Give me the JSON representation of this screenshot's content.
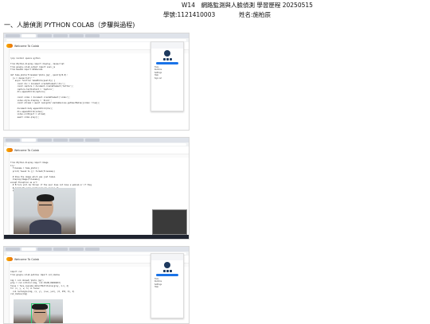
{
  "header": {
    "title": "W14　網路監測與人臉偵測 學習歷程 20250515",
    "student_id": "學號:1121410003",
    "student_name": "姓名:施柏辰"
  },
  "section": {
    "heading": "一、人臉偵測 PYTHON COLAB（步驟與過程)"
  },
  "screenshots": [
    {
      "notebook": "Welcome To Colab",
      "code_lines": [
        "!pip install opencv-python",
        "",
        "from IPython.display import display, Javascript",
        "from google.colab.output import eval_js",
        "from base64 import b64decode",
        "",
        "def take_photo(filename='photo.jpg', quality=0.8):",
        "  js = Javascript('''",
        "    async function takePhoto(quality) {",
        "      const div = document.createElement('div');",
        "      const capture = document.createElement('button');",
        "      capture.textContent = 'Capture';",
        "      div.appendChild(capture);",
        "",
        "      const video = document.createElement('video');",
        "      video.style.display = 'block';",
        "      const stream = await navigator.mediaDevices.getUserMedia({video: true});",
        "",
        "      document.body.appendChild(div);",
        "      div.appendChild(video);",
        "      video.srcObject = stream;",
        "      await video.play();"
      ]
    },
    {
      "notebook": "Welcome To Colab",
      "code_lines": [
        "from IPython.display import Image",
        "try:",
        "  filename = take_photo()",
        "  print('Saved to {}'.format(filename))",
        "",
        "  # Show the image which was just taken.",
        "  display(Image(filename))",
        "except Exception as err:",
        "  # Errors will be thrown if the user does not have a webcam or if they",
        "  # grant the page permission to access it.",
        "  print(str(err))"
      ]
    },
    {
      "notebook": "Welcome To Colab",
      "code_lines": [
        "import cv2",
        "from google.colab.patches import cv2_imshow",
        "",
        "img = cv2.imread('photo.jpg')",
        "gray = cv2.cvtColor(img, cv2.COLOR_BGR2GRAY)",
        "faces = face_cascade.detectMultiScale(gray, 1.1, 4)",
        "for (x, y, w, h) in faces:",
        "  cv2.rectangle(img, (x, y), (x+w, y+h), (0, 255, 0), 2)",
        "cv2_imshow(img)"
      ]
    }
  ],
  "side_panel": {
    "items": [
      "Tools",
      "Runtime",
      "Settings",
      "Help",
      "Sign out"
    ]
  },
  "colors": {
    "accent": "#1a73e8",
    "face_box": "#2ecc71"
  }
}
